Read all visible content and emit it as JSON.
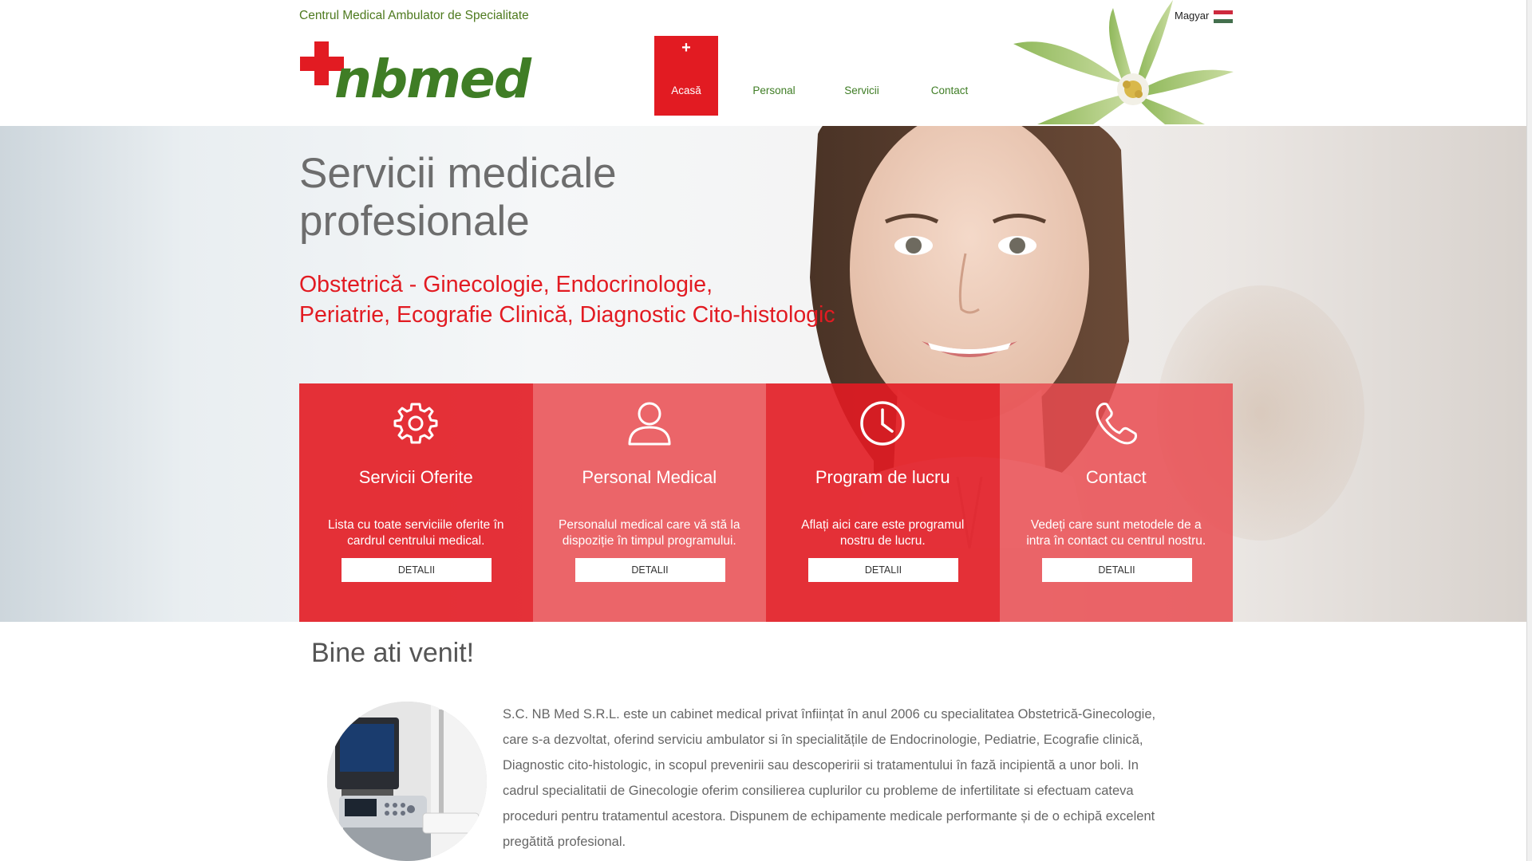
{
  "header": {
    "tagline": "Centrul Medical Ambulator de Specialitate",
    "logo_text": "nbmed",
    "language": "Magyar",
    "nav": [
      {
        "label": "Acasă",
        "active": true
      },
      {
        "label": "Personal",
        "active": false
      },
      {
        "label": "Servicii",
        "active": false
      },
      {
        "label": "Contact",
        "active": false
      }
    ]
  },
  "hero": {
    "title_line1": "Servicii medicale",
    "title_line2": "profesionale",
    "subtitle_line1": "Obstetrică - Ginecologie, Endocrinologie,",
    "subtitle_line2": "Periatrie, Ecografie Clinică, Diagnostic Cito-histologic"
  },
  "cards": [
    {
      "icon": "gear-icon",
      "title": "Servicii Oferite",
      "text": "Lista cu toate serviciile oferite în cardrul centrului medical.",
      "button": "DETALII"
    },
    {
      "icon": "user-icon",
      "title": "Personal Medical",
      "text": "Personalul medical care vă stă la dispoziție în timpul programului.",
      "button": "DETALII"
    },
    {
      "icon": "clock-icon",
      "title": "Program de lucru",
      "text": "Aflați aici care este programul nostru de lucru.",
      "button": "DETALII"
    },
    {
      "icon": "phone-icon",
      "title": "Contact",
      "text": "Vedeți care sunt metodele de a intra în contact cu centrul nostru.",
      "button": "DETALII"
    }
  ],
  "welcome": {
    "title": "Bine ati venit!",
    "text": "S.C. NB Med S.R.L. este un cabinet medical privat înființat în anul 2006 cu specialitatea Obstetrică-Ginecologie, care s-a dezvoltat, oferind serviciu ambulator si în specialitățile de Endocrinologie, Pediatrie, Ecografie clinică, Diagnostic cito-histologic, in scopul prevenirii sau descoperirii si tratamentului în fază incipientă a unor boli. In cadrul specialitatii de Ginecologie oferim consilierea cuplurilor cu probleme de infertilitate si efectuam cateva proceduri pentru tratamentul acestora. Dispunem de echipamente medicale performante și de o echipă excelent pregătită profesional."
  },
  "colors": {
    "brand_red": "#e21b22",
    "brand_green": "#3f7d25",
    "card_light_red": "#e94b50"
  }
}
